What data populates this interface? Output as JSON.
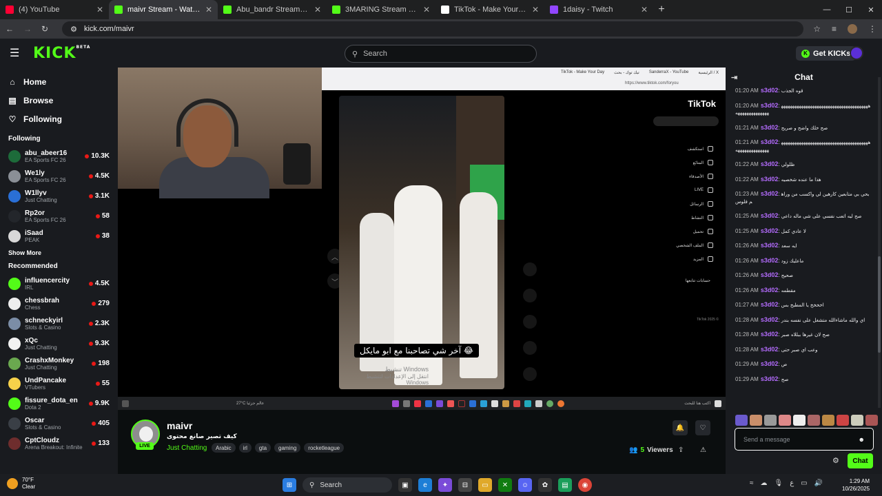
{
  "browser": {
    "tabs": [
      {
        "title": "(4) YouTube",
        "fav": "youtube-icon",
        "color": "#ff0033",
        "active": false
      },
      {
        "title": "maivr Stream - Watch Live",
        "fav": "kick-icon",
        "color": "#53fc18",
        "active": true
      },
      {
        "title": "Abu_bandr Stream - Watch Live",
        "fav": "kick-icon",
        "color": "#53fc18",
        "active": false
      },
      {
        "title": "3MARING Stream - Watch Live",
        "fav": "kick-icon",
        "color": "#53fc18",
        "active": false
      },
      {
        "title": "TikTok - Make Your Day",
        "fav": "tiktok-icon",
        "color": "#ffffff",
        "active": false
      },
      {
        "title": "1daisy - Twitch",
        "fav": "twitch-icon",
        "color": "#9146ff",
        "active": false
      }
    ],
    "url": "kick.com/maivr"
  },
  "topnav": {
    "logo": "KICK",
    "logo_beta": "BETA",
    "search_placeholder": "Search",
    "get_kicks": "Get KICKs"
  },
  "sidebar": {
    "nav": [
      {
        "label": "Home",
        "icon": "home-icon"
      },
      {
        "label": "Browse",
        "icon": "browse-icon"
      },
      {
        "label": "Following",
        "icon": "heart-icon"
      }
    ],
    "following_header": "Following",
    "following": [
      {
        "name": "abu_abeer16",
        "category": "EA Sports FC 26",
        "viewers": "10.3K",
        "color": "#1d6b3a"
      },
      {
        "name": "We1ly",
        "category": "EA Sports FC 26",
        "viewers": "4.5K",
        "color": "#8a8f96"
      },
      {
        "name": "W1llyv",
        "category": "Just Chatting",
        "viewers": "3.1K",
        "color": "#2a6fd6"
      },
      {
        "name": "Rp2or",
        "category": "EA Sports FC 26",
        "viewers": "58",
        "color": "#23262b"
      },
      {
        "name": "iSaad",
        "category": "PEAK",
        "viewers": "38",
        "color": "#d8d8d8"
      }
    ],
    "show_more": "Show More",
    "recommended_header": "Recommended",
    "recommended": [
      {
        "name": "influencercity",
        "category": "IRL",
        "viewers": "4.5K",
        "color": "#53fc18"
      },
      {
        "name": "chessbrah",
        "category": "Chess",
        "viewers": "279",
        "color": "#eeeeee"
      },
      {
        "name": "schneckyirl",
        "category": "Slots & Casino",
        "viewers": "2.3K",
        "color": "#7b8da6"
      },
      {
        "name": "xQc",
        "category": "Just Chatting",
        "viewers": "9.3K",
        "color": "#f2f2f2"
      },
      {
        "name": "CrashxMonkey",
        "category": "Just Chatting",
        "viewers": "198",
        "color": "#6aa84f"
      },
      {
        "name": "UndPancake",
        "category": "VTubers",
        "viewers": "55",
        "color": "#f7d24a"
      },
      {
        "name": "fissure_dota_en",
        "category": "Dota 2",
        "viewers": "9.9K",
        "color": "#53fc18"
      },
      {
        "name": "Oscar",
        "category": "Slots & Casino",
        "viewers": "405",
        "color": "#3a3f46"
      },
      {
        "name": "CptCloudz",
        "category": "Arena Breakout: Infinite",
        "viewers": "133",
        "color": "#6e2d2d"
      }
    ]
  },
  "video": {
    "inner_tabs": [
      "TikTok - Make Your Day",
      "تيك توك - بحث",
      "SanderraX - YouTube",
      "الرئيسية / X"
    ],
    "inner_url": "https://www.tiktok.com/foryou",
    "tiktok_logo": "TikTok",
    "caption": "آخر شي تصاحبنا مع ابو مايكل 😂",
    "tiktok_menu": [
      "استكشف",
      "المتابَع",
      "الأصدقاء",
      "LIVE",
      "الرسائل",
      "النشاط",
      "تحميل",
      "الملف الشخصي",
      "المزيد"
    ],
    "tiktok_following": "حسابات تتابعها",
    "tiktok_copyright": "TikTok 2025 ©",
    "windows_activate": "تنشيط Windows",
    "windows_activate_sub": "انتقل إلى الإعدادات لتنشيط Windows",
    "inner_taskbar_search": "اكتب هنا للبحث",
    "inner_weather": "27°C عالم جزئيا"
  },
  "streamer": {
    "name": "maivr",
    "live_badge": "LIVE",
    "title": "كيف تصير صانع محتوى",
    "category": "Just Chatting",
    "tags": [
      "Arabic",
      "irl",
      "gta",
      "gaming",
      "rocketleague"
    ],
    "viewers_count": "5",
    "viewers_label": "Viewers"
  },
  "chat": {
    "title": "Chat",
    "messages": [
      {
        "time": "01:20 AM",
        "user": "s3d02",
        "text": "قوه الجذب"
      },
      {
        "time": "01:20 AM",
        "user": "s3d02",
        "text": "ههههههههههههههههههههههههههههههههههههههههههههههههههههههه"
      },
      {
        "time": "01:21 AM",
        "user": "s3d02",
        "text": "صح خلك واضح و صريح"
      },
      {
        "time": "01:21 AM",
        "user": "s3d02",
        "text": "ههههههههههههههههههههههههههههههههههههههههههههههههههههههه"
      },
      {
        "time": "01:22 AM",
        "user": "s3d02",
        "text": "ظلولي"
      },
      {
        "time": "01:22 AM",
        "user": "s3d02",
        "text": "هذا ما عنده شخصيه"
      },
      {
        "time": "01:23 AM",
        "user": "s3d02",
        "text": "بحي بي متابعين كارهين لي واكسب من وراهم فلوس"
      },
      {
        "time": "01:25 AM",
        "user": "s3d02",
        "text": "صح ليه اتعب نفسي على شي ماله داعي"
      },
      {
        "time": "01:25 AM",
        "user": "s3d02",
        "text": "لا عادي كمل"
      },
      {
        "time": "01:26 AM",
        "user": "s3d02",
        "text": "ايه سعد"
      },
      {
        "time": "01:26 AM",
        "user": "s3d02",
        "text": "ماعليك زود"
      },
      {
        "time": "01:26 AM",
        "user": "s3d02",
        "text": "صحيح"
      },
      {
        "time": "01:26 AM",
        "user": "s3d02",
        "text": "مقطمه"
      },
      {
        "time": "01:27 AM",
        "user": "s3d02",
        "text": "اخخخخ يا المطبخ بس"
      },
      {
        "time": "01:28 AM",
        "user": "s3d02",
        "text": "اي والله ماشاءالله متشغل على نفسه بندر"
      },
      {
        "time": "01:28 AM",
        "user": "s3d02",
        "text": "صح لان غيرها ببللاه صبر"
      },
      {
        "time": "01:28 AM",
        "user": "s3d02",
        "text": "وعب اي صبر حتى"
      },
      {
        "time": "01:29 AM",
        "user": "s3d02",
        "text": "ص"
      },
      {
        "time": "01:29 AM",
        "user": "s3d02",
        "text": "صح"
      }
    ],
    "input_placeholder": "Send a message",
    "send_button": "Chat"
  },
  "taskbar": {
    "weather_temp": "70°F",
    "weather_cond": "Clear",
    "search": "Search",
    "time": "1:29 AM",
    "date": "10/26/2025"
  }
}
